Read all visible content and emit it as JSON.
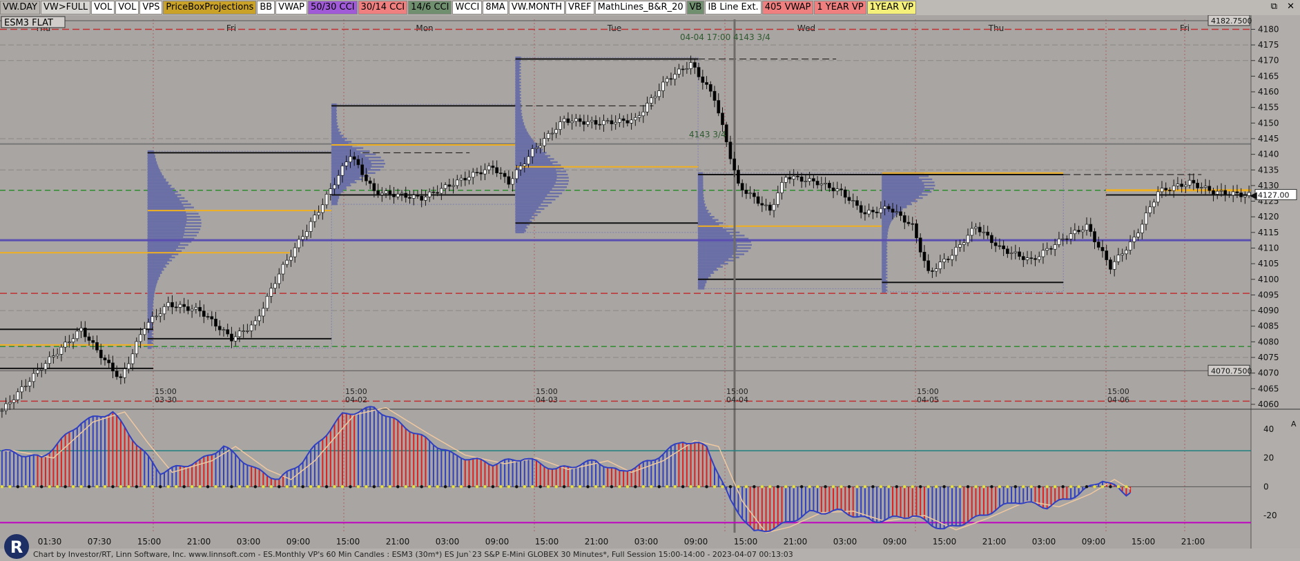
{
  "toolbar": {
    "buttons": [
      {
        "label": "VW.DAY",
        "bg": "#b8b5b1"
      },
      {
        "label": "VW>FULL",
        "bg": "#d8d6d2"
      },
      {
        "label": "VOL",
        "bg": "#ffffff"
      },
      {
        "label": "VOL",
        "bg": "#ffffff"
      },
      {
        "label": "VPS",
        "bg": "#ffffff"
      },
      {
        "label": "PriceBoxProjections",
        "bg": "#c9a227"
      },
      {
        "label": "BB",
        "bg": "#ffffff"
      },
      {
        "label": "VWAP",
        "bg": "#ffffff"
      },
      {
        "label": "50/30 CCI",
        "bg": "#a05ad8"
      },
      {
        "label": "30/14 CCI",
        "bg": "#f08080"
      },
      {
        "label": "14/6 CCI",
        "bg": "#6f8f6f"
      },
      {
        "label": "WCCI",
        "bg": "#ffffff"
      },
      {
        "label": "8MA",
        "bg": "#ffffff"
      },
      {
        "label": "VW.MONTH",
        "bg": "#ffffff"
      },
      {
        "label": "VREF",
        "bg": "#ffffff"
      },
      {
        "label": "MathLines_B&R_20",
        "bg": "#ffffff"
      },
      {
        "label": "VB",
        "bg": "#6f8f6f"
      },
      {
        "label": "IB Line Ext.",
        "bg": "#ffffff"
      },
      {
        "label": "405 VWAP",
        "bg": "#f08080"
      },
      {
        "label": "1 YEAR VP",
        "bg": "#f08080"
      },
      {
        "label": "1YEAR VP",
        "bg": "#f5f07a"
      }
    ]
  },
  "symbol_label": "ESM3 FLAT",
  "price_axis": {
    "ticks": [
      "4180",
      "4175",
      "4170",
      "4165",
      "4160",
      "4155",
      "4150",
      "4145",
      "4140",
      "4135",
      "4130",
      "4125",
      "4120",
      "4115",
      "4110",
      "4105",
      "4100",
      "4095",
      "4090",
      "4085",
      "4080",
      "4075",
      "4070",
      "4065",
      "4060"
    ],
    "top_box": "4182.7500",
    "last_price": "4127.00",
    "low_box": "4070.7500"
  },
  "day_labels": [
    "Thu",
    "Fri",
    "Mon",
    "Tue",
    "Wed",
    "Thu",
    "Fri"
  ],
  "session_markers": [
    {
      "time": "15:00",
      "date": "03-30"
    },
    {
      "time": "15:00",
      "date": "04-02"
    },
    {
      "time": "15:00",
      "date": "04-03"
    },
    {
      "time": "15:00",
      "date": "04-04"
    },
    {
      "time": "15:00",
      "date": "04-05"
    },
    {
      "time": "15:00",
      "date": "04-06"
    }
  ],
  "annotations": {
    "top_note": "04-04 17:00  4143 3/4",
    "mid_note": "4143 3/4"
  },
  "osc_axis": {
    "ticks": [
      "40",
      "20",
      "0",
      "-20"
    ]
  },
  "time_axis": [
    "01:30",
    "07:30",
    "15:00",
    "21:00",
    "03:00",
    "09:00",
    "15:00",
    "21:00",
    "03:00",
    "09:00",
    "15:00",
    "21:00",
    "03:00",
    "09:00",
    "15:00",
    "21:00",
    "03:00",
    "09:00",
    "15:00",
    "21:00",
    "03:00",
    "09:00",
    "15:00",
    "21:00"
  ],
  "footer": "Chart by Investor/RT, Linn Software, Inc. www.linnsoft.com - ES.Monthly VP's 60 Min Candles : ESM3 (30m*) ES Jun`23 S&P E-Mini GLOBEX 30 Minutes*, Full Session 15:00-14:00 - 2023-04-07 00:13:03",
  "colors": {
    "background": "#a8a5a2",
    "up_candle": "#ffffff",
    "down_candle": "#000000",
    "vwap_gold": "#f0b020",
    "purple_line": "#5a4fb0",
    "red_dash": "#c03030",
    "green_dash": "#2e8b2e",
    "volume_profile": "#6a6fa6",
    "osc_red": "#e02020",
    "osc_blue": "#3040c0",
    "magenta": "#c000c0",
    "teal": "#208080"
  },
  "chart_data": {
    "type": "candlestick",
    "title": "ESM3 FLAT",
    "ylim": [
      4058,
      4182.75
    ],
    "key_levels": {
      "purple": 4112.5,
      "red_dashes": [
        4180,
        4095.5,
        4061
      ],
      "green_dashes": [
        4128.5,
        4078.5
      ],
      "top_line": 4182.75,
      "low_line": 4070.75
    },
    "price_path_anchors": [
      {
        "i": 0,
        "p": 4058
      },
      {
        "i": 10,
        "p": 4072
      },
      {
        "i": 20,
        "p": 4084
      },
      {
        "i": 26,
        "p": 4074
      },
      {
        "i": 30,
        "p": 4068
      },
      {
        "i": 36,
        "p": 4085
      },
      {
        "i": 42,
        "p": 4092
      },
      {
        "i": 50,
        "p": 4090
      },
      {
        "i": 58,
        "p": 4081
      },
      {
        "i": 64,
        "p": 4086
      },
      {
        "i": 70,
        "p": 4102
      },
      {
        "i": 80,
        "p": 4122
      },
      {
        "i": 88,
        "p": 4140
      },
      {
        "i": 94,
        "p": 4128
      },
      {
        "i": 106,
        "p": 4126
      },
      {
        "i": 118,
        "p": 4133
      },
      {
        "i": 124,
        "p": 4136
      },
      {
        "i": 128,
        "p": 4131
      },
      {
        "i": 134,
        "p": 4141
      },
      {
        "i": 142,
        "p": 4151
      },
      {
        "i": 150,
        "p": 4150
      },
      {
        "i": 160,
        "p": 4151
      },
      {
        "i": 168,
        "p": 4164
      },
      {
        "i": 174,
        "p": 4169
      },
      {
        "i": 180,
        "p": 4158
      },
      {
        "i": 186,
        "p": 4130
      },
      {
        "i": 194,
        "p": 4122
      },
      {
        "i": 198,
        "p": 4133
      },
      {
        "i": 206,
        "p": 4131
      },
      {
        "i": 212,
        "p": 4128
      },
      {
        "i": 218,
        "p": 4121
      },
      {
        "i": 224,
        "p": 4123
      },
      {
        "i": 230,
        "p": 4117
      },
      {
        "i": 234,
        "p": 4102
      },
      {
        "i": 240,
        "p": 4108
      },
      {
        "i": 246,
        "p": 4117
      },
      {
        "i": 252,
        "p": 4110
      },
      {
        "i": 260,
        "p": 4106
      },
      {
        "i": 268,
        "p": 4113
      },
      {
        "i": 274,
        "p": 4117
      },
      {
        "i": 280,
        "p": 4104
      },
      {
        "i": 286,
        "p": 4113
      },
      {
        "i": 292,
        "p": 4128
      },
      {
        "i": 300,
        "p": 4131
      },
      {
        "i": 306,
        "p": 4128
      },
      {
        "i": 314,
        "p": 4127
      }
    ],
    "volume_profiles": [
      {
        "x_from": 0.118,
        "x_to": 0.265,
        "top": 4141,
        "bottom": 4078,
        "poc": 4118
      },
      {
        "x_from": 0.265,
        "x_to": 0.412,
        "top": 4156,
        "bottom": 4124,
        "poc": 4137
      },
      {
        "x_from": 0.412,
        "x_to": 0.558,
        "top": 4171,
        "bottom": 4115,
        "poc": 4132
      },
      {
        "x_from": 0.558,
        "x_to": 0.705,
        "top": 4134,
        "bottom": 4097,
        "poc": 4111
      },
      {
        "x_from": 0.705,
        "x_to": 0.85,
        "top": 4134,
        "bottom": 4096,
        "poc": 4130
      }
    ],
    "oscillator": {
      "ylim": [
        -32,
        52
      ],
      "levels": {
        "upper_teal": 25,
        "lower_magenta": -25
      },
      "histogram_anchors": [
        {
          "i": 0,
          "v": 25
        },
        {
          "i": 10,
          "v": 20
        },
        {
          "i": 20,
          "v": 45
        },
        {
          "i": 28,
          "v": 52
        },
        {
          "i": 34,
          "v": 30
        },
        {
          "i": 40,
          "v": 10
        },
        {
          "i": 50,
          "v": 18
        },
        {
          "i": 56,
          "v": 28
        },
        {
          "i": 64,
          "v": 12
        },
        {
          "i": 70,
          "v": 5
        },
        {
          "i": 76,
          "v": 18
        },
        {
          "i": 86,
          "v": 50
        },
        {
          "i": 94,
          "v": 55
        },
        {
          "i": 104,
          "v": 38
        },
        {
          "i": 114,
          "v": 22
        },
        {
          "i": 124,
          "v": 16
        },
        {
          "i": 132,
          "v": 20
        },
        {
          "i": 140,
          "v": 12
        },
        {
          "i": 150,
          "v": 18
        },
        {
          "i": 156,
          "v": 10
        },
        {
          "i": 164,
          "v": 18
        },
        {
          "i": 172,
          "v": 32
        },
        {
          "i": 178,
          "v": 28
        },
        {
          "i": 184,
          "v": -10
        },
        {
          "i": 190,
          "v": -32
        },
        {
          "i": 196,
          "v": -28
        },
        {
          "i": 204,
          "v": -18
        },
        {
          "i": 212,
          "v": -17
        },
        {
          "i": 220,
          "v": -24
        },
        {
          "i": 230,
          "v": -20
        },
        {
          "i": 238,
          "v": -30
        },
        {
          "i": 246,
          "v": -22
        },
        {
          "i": 256,
          "v": -10
        },
        {
          "i": 264,
          "v": -14
        },
        {
          "i": 272,
          "v": -5
        },
        {
          "i": 278,
          "v": 5
        },
        {
          "i": 284,
          "v": -5
        },
        {
          "i": 290,
          "v": 8
        },
        {
          "i": 298,
          "v": 20
        },
        {
          "i": 304,
          "v": 18
        },
        {
          "i": 314,
          "v": 12
        }
      ]
    }
  }
}
